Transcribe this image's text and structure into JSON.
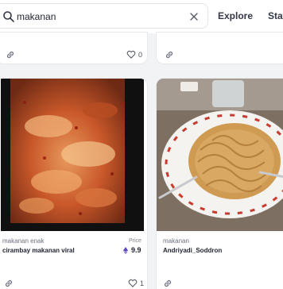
{
  "search": {
    "value": "makanan",
    "placeholder": ""
  },
  "nav": {
    "explore": "Explore",
    "stats": "Stat"
  },
  "top_cards": [
    {
      "likes": "0"
    },
    {}
  ],
  "cards": [
    {
      "collection": "makanan enak",
      "title": "cirambay makanan viral",
      "price_label": "Price",
      "price": "9.9",
      "likes": "1"
    },
    {
      "collection": "makanan",
      "title": "Andriyadi_Soddron"
    }
  ],
  "colors": {
    "eth": "#5b46c9",
    "border": "#e6e8ec",
    "background": "#f2f3f5"
  }
}
